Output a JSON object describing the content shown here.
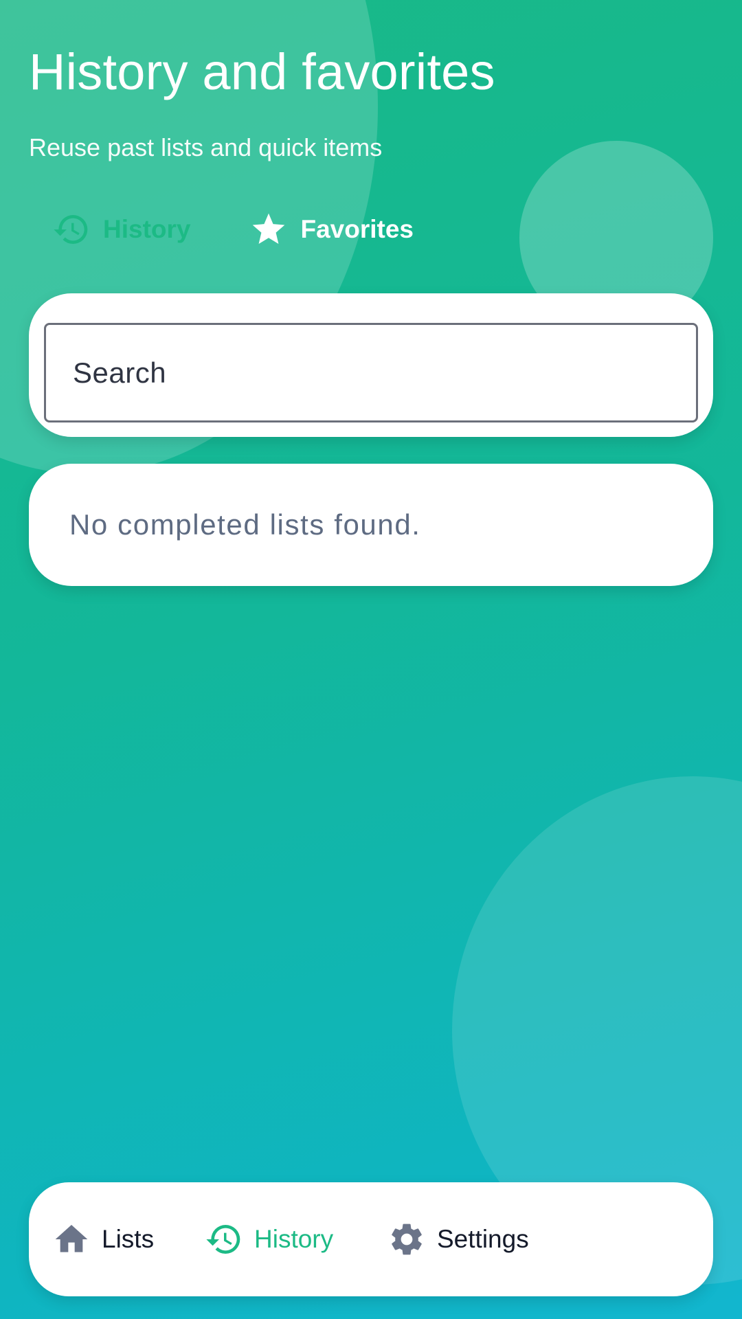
{
  "header": {
    "title": "History and favorites",
    "subtitle": "Reuse past lists and quick items"
  },
  "tabs": [
    {
      "label": "History",
      "icon": "history-icon",
      "selected": false
    },
    {
      "label": "Favorites",
      "icon": "star-icon",
      "selected": true
    }
  ],
  "search": {
    "placeholder": "Search",
    "value": ""
  },
  "empty_state": {
    "message": "No completed lists found."
  },
  "bottom_nav": {
    "items": [
      {
        "label": "Lists",
        "icon": "home-icon",
        "active": false
      },
      {
        "label": "History",
        "icon": "history-icon",
        "active": true
      },
      {
        "label": "Settings",
        "icon": "gear-icon",
        "active": false
      }
    ]
  },
  "colors": {
    "accent": "#1cba85",
    "gradient_start": "#19b987",
    "gradient_end": "#12b6cf",
    "nav_icon_inactive": "#6b7489",
    "muted_text": "#5e6b82"
  }
}
